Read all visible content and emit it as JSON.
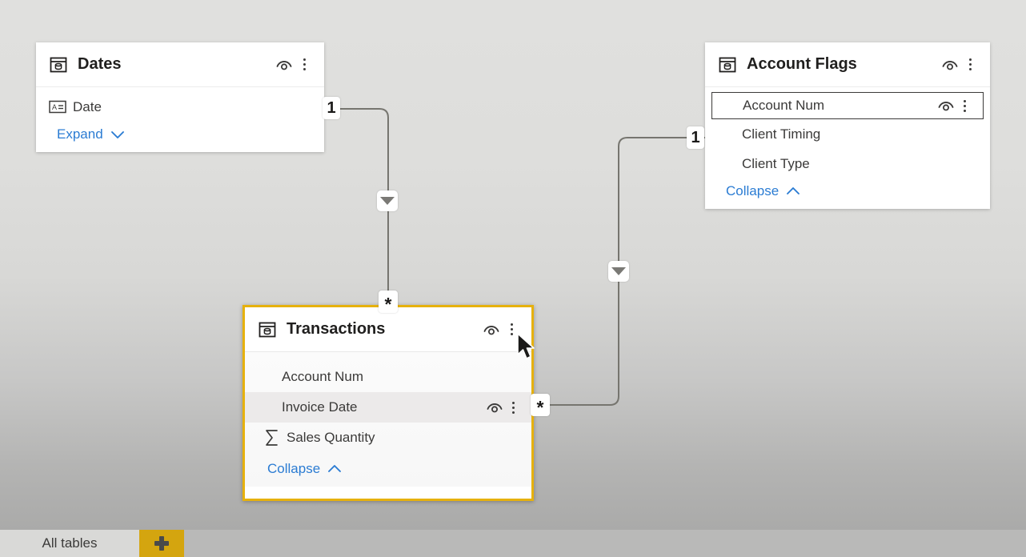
{
  "app": {
    "view_name": "model-view",
    "background_top_color": "#e0e0de",
    "background_bottom_color": "#aaaaa9",
    "selection_color": "#e6b10e",
    "link_color": "#2b7cd3"
  },
  "tables": [
    {
      "name": "Dates",
      "icon": "table-icon",
      "selected": false,
      "expand_label": "Expand",
      "expand_state": "collapsed",
      "fields": [
        {
          "label": "Date",
          "icon": "text-field-icon"
        }
      ]
    },
    {
      "name": "Account Flags",
      "icon": "table-icon",
      "selected": false,
      "expand_label": "Collapse",
      "expand_state": "expanded",
      "fields": [
        {
          "label": "Account Num",
          "icon": "none",
          "state": "focused"
        },
        {
          "label": "Client Timing",
          "icon": "none",
          "state": "normal"
        },
        {
          "label": "Client Type",
          "icon": "none",
          "state": "normal"
        }
      ]
    },
    {
      "name": "Transactions",
      "icon": "table-icon",
      "selected": true,
      "expand_label": "Collapse",
      "expand_state": "expanded",
      "fields": [
        {
          "label": "Account Num",
          "icon": "none",
          "state": "normal"
        },
        {
          "label": "Invoice Date",
          "icon": "none",
          "state": "hovered"
        },
        {
          "label": "Sales Quantity",
          "icon": "sigma-icon",
          "state": "normal"
        }
      ]
    }
  ],
  "relationships": [
    {
      "from_table": "Dates",
      "to_table": "Transactions",
      "from_cardinality": "1",
      "to_cardinality": "*",
      "cross_filter_direction": "single",
      "arrow_icon": "filter-arrow-down-icon"
    },
    {
      "from_table": "Account Flags",
      "to_table": "Transactions",
      "from_cardinality": "1",
      "to_cardinality": "*",
      "cross_filter_direction": "single",
      "arrow_icon": "filter-arrow-down-icon"
    }
  ],
  "header_actions": {
    "hide_label": "hide-eye-icon",
    "more_label": "more-options-icon"
  },
  "bottom_bar": {
    "tab_label": "All tables",
    "add_label": "+"
  }
}
